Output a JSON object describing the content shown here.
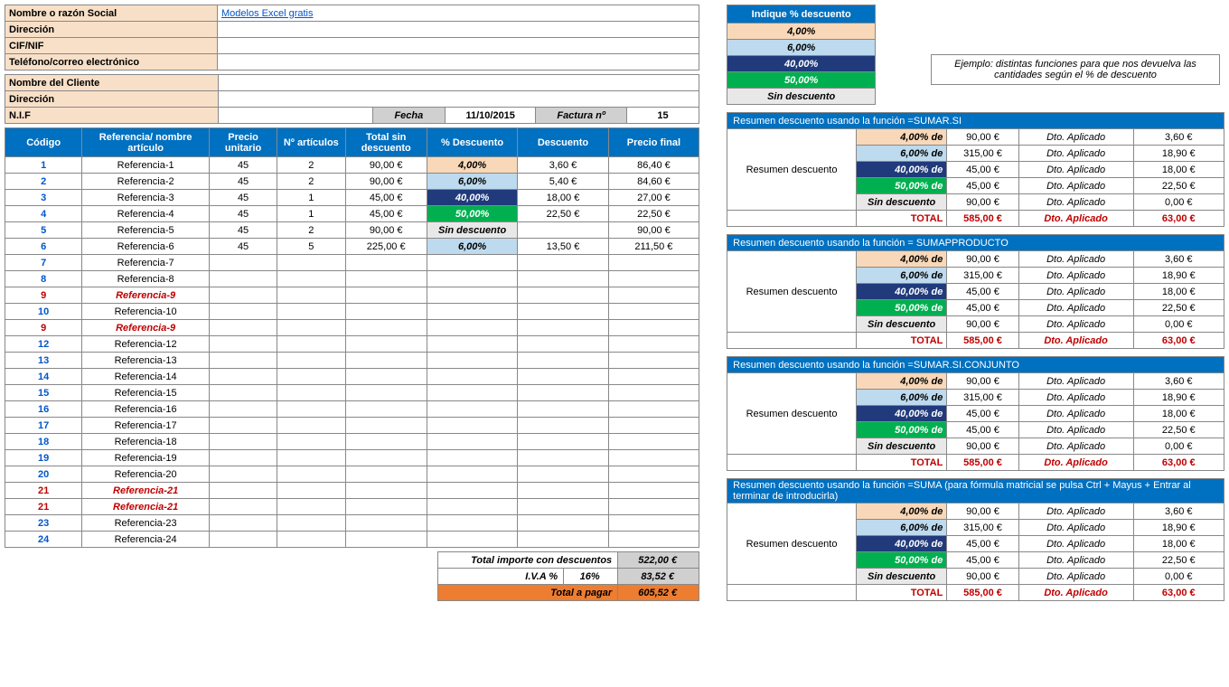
{
  "company": {
    "name_lbl": "Nombre o razón Social",
    "name_val": "Modelos Excel gratis",
    "addr_lbl": "Dirección",
    "cif_lbl": "CIF/NIF",
    "tel_lbl": "Teléfono/correo electrónico"
  },
  "client": {
    "name_lbl": "Nombre del Cliente",
    "addr_lbl": "Dirección",
    "nif_lbl": "N.I.F",
    "fecha_lbl": "Fecha",
    "fecha_val": "11/10/2015",
    "fact_lbl": "Factura nº",
    "fact_val": "15"
  },
  "headers": {
    "codigo": "Código",
    "ref": "Referencia/ nombre artículo",
    "pu": "Precio unitario",
    "na": "Nº artículos",
    "tsd": "Total sin descuento",
    "pd": "% Descuento",
    "desc": "Descuento",
    "pf": "Precio final"
  },
  "items": [
    {
      "c": "1",
      "r": "Referencia-1",
      "p": "45",
      "n": "2",
      "t": "90,00 €",
      "pd": "4,00%",
      "pdcls": "disc4",
      "d": "3,60 €",
      "f": "86,40 €"
    },
    {
      "c": "2",
      "r": "Referencia-2",
      "p": "45",
      "n": "2",
      "t": "90,00 €",
      "pd": "6,00%",
      "pdcls": "disc6",
      "d": "5,40 €",
      "f": "84,60 €"
    },
    {
      "c": "3",
      "r": "Referencia-3",
      "p": "45",
      "n": "1",
      "t": "45,00 €",
      "pd": "40,00%",
      "pdcls": "disc40",
      "d": "18,00 €",
      "f": "27,00 €"
    },
    {
      "c": "4",
      "r": "Referencia-4",
      "p": "45",
      "n": "1",
      "t": "45,00 €",
      "pd": "50,00%",
      "pdcls": "disc50",
      "d": "22,50 €",
      "f": "22,50 €"
    },
    {
      "c": "5",
      "r": "Referencia-5",
      "p": "45",
      "n": "2",
      "t": "90,00 €",
      "pd": "Sin descuento",
      "pdcls": "disc-sin",
      "d": "",
      "f": "90,00 €"
    },
    {
      "c": "6",
      "r": "Referencia-6",
      "p": "45",
      "n": "5",
      "t": "225,00 €",
      "pd": "6,00%",
      "pdcls": "disc6",
      "d": "13,50 €",
      "f": "211,50 €"
    },
    {
      "c": "7",
      "r": "Referencia-7"
    },
    {
      "c": "8",
      "r": "Referencia-8"
    },
    {
      "c": "9",
      "r": "Referencia-9",
      "red": true
    },
    {
      "c": "10",
      "r": "Referencia-10"
    },
    {
      "c": "9",
      "r": "Referencia-9",
      "red": true
    },
    {
      "c": "12",
      "r": "Referencia-12"
    },
    {
      "c": "13",
      "r": "Referencia-13"
    },
    {
      "c": "14",
      "r": "Referencia-14"
    },
    {
      "c": "15",
      "r": "Referencia-15"
    },
    {
      "c": "16",
      "r": "Referencia-16"
    },
    {
      "c": "17",
      "r": "Referencia-17"
    },
    {
      "c": "18",
      "r": "Referencia-18"
    },
    {
      "c": "19",
      "r": "Referencia-19"
    },
    {
      "c": "20",
      "r": "Referencia-20"
    },
    {
      "c": "21",
      "r": "Referencia-21",
      "red": true
    },
    {
      "c": "21",
      "r": "Referencia-21",
      "red": true
    },
    {
      "c": "23",
      "r": "Referencia-23"
    },
    {
      "c": "24",
      "r": "Referencia-24"
    }
  ],
  "totals": {
    "line1_lbl": "Total importe con descuentos",
    "line1_val": "522,00 €",
    "line2_lbl": "I.V.A %",
    "line2_pct": "16%",
    "line2_val": "83,52 €",
    "line3_lbl": "Total a pagar",
    "line3_val": "605,52 €"
  },
  "indique": {
    "title": "Indique % descuento",
    "r1": "4,00%",
    "r2": "6,00%",
    "r3": "40,00%",
    "r4": "50,00%",
    "r5": "Sin descuento"
  },
  "ejemplo": "Ejemplo: distintas funciones para que nos devuelva las cantidades según el % de descuento",
  "sum_common": {
    "side": "Resumen descuento",
    "de": "de",
    "dto": "Dto. Aplicado",
    "total": "TOTAL",
    "rows": [
      {
        "p": "4,00%",
        "cls": "disc4",
        "a": "90,00 €",
        "v": "3,60 €"
      },
      {
        "p": "6,00%",
        "cls": "disc6",
        "a": "315,00 €",
        "v": "18,90 €"
      },
      {
        "p": "40,00%",
        "cls": "disc40",
        "a": "45,00 €",
        "v": "18,00 €"
      },
      {
        "p": "50,00%",
        "cls": "disc50",
        "a": "45,00 €",
        "v": "22,50 €"
      },
      {
        "p": "Sin descuento",
        "cls": "disc-sin",
        "a": "90,00 €",
        "v": "0,00 €"
      }
    ],
    "tot_a": "585,00 €",
    "tot_v": "63,00 €"
  },
  "sum_titles": {
    "t1": "Resumen descuento usando la función =SUMAR.SI",
    "t2": "Resumen descuento usando la función = SUMAPPRODUCTO",
    "t3": "Resumen descuento usando la función   =SUMAR.SI.CONJUNTO",
    "t4": "Resumen descuento usando la función =SUMA   (para fórmula matricial se pulsa Ctrl + Mayus + Entrar al terminar de introducirla)"
  }
}
